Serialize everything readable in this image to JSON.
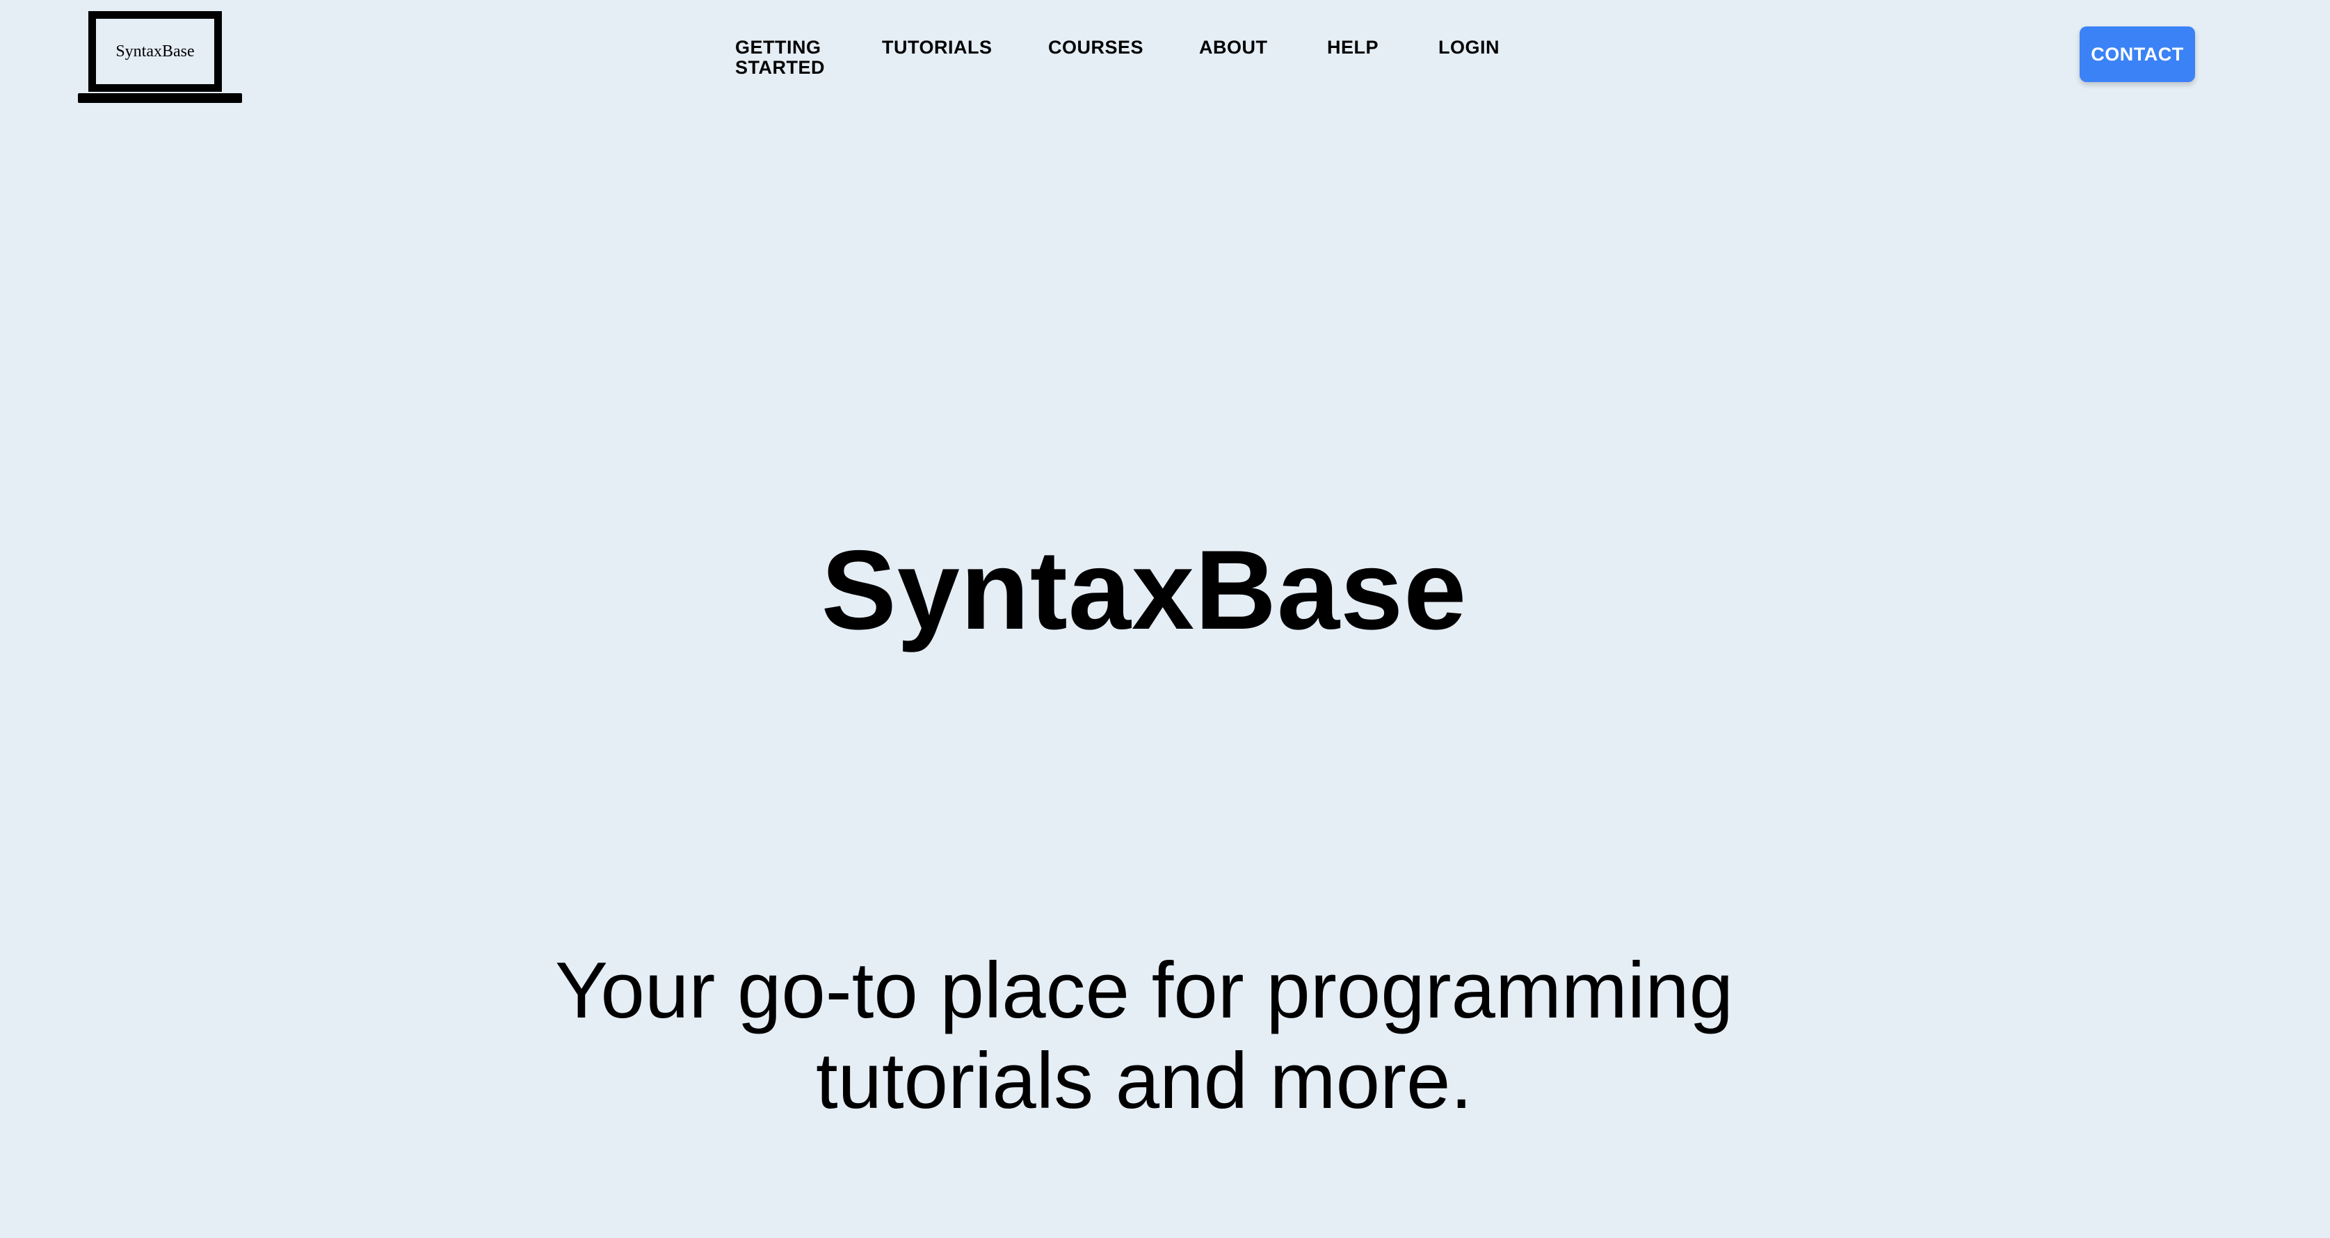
{
  "logo": {
    "text": "SyntaxBase",
    "icon": "laptop-icon"
  },
  "nav": {
    "items": [
      {
        "label": "GETTING STARTED"
      },
      {
        "label": "TUTORIALS"
      },
      {
        "label": "COURSES"
      },
      {
        "label": "ABOUT"
      },
      {
        "label": "HELP"
      },
      {
        "label": "LOGIN"
      }
    ]
  },
  "header": {
    "contact_label": "CONTACT"
  },
  "hero": {
    "title": "SyntaxBase",
    "subtitle": "Your go-to place for programming tutorials and more."
  },
  "colors": {
    "background": "#e5edf5",
    "accent": "#3b82f6",
    "text": "#000000"
  }
}
